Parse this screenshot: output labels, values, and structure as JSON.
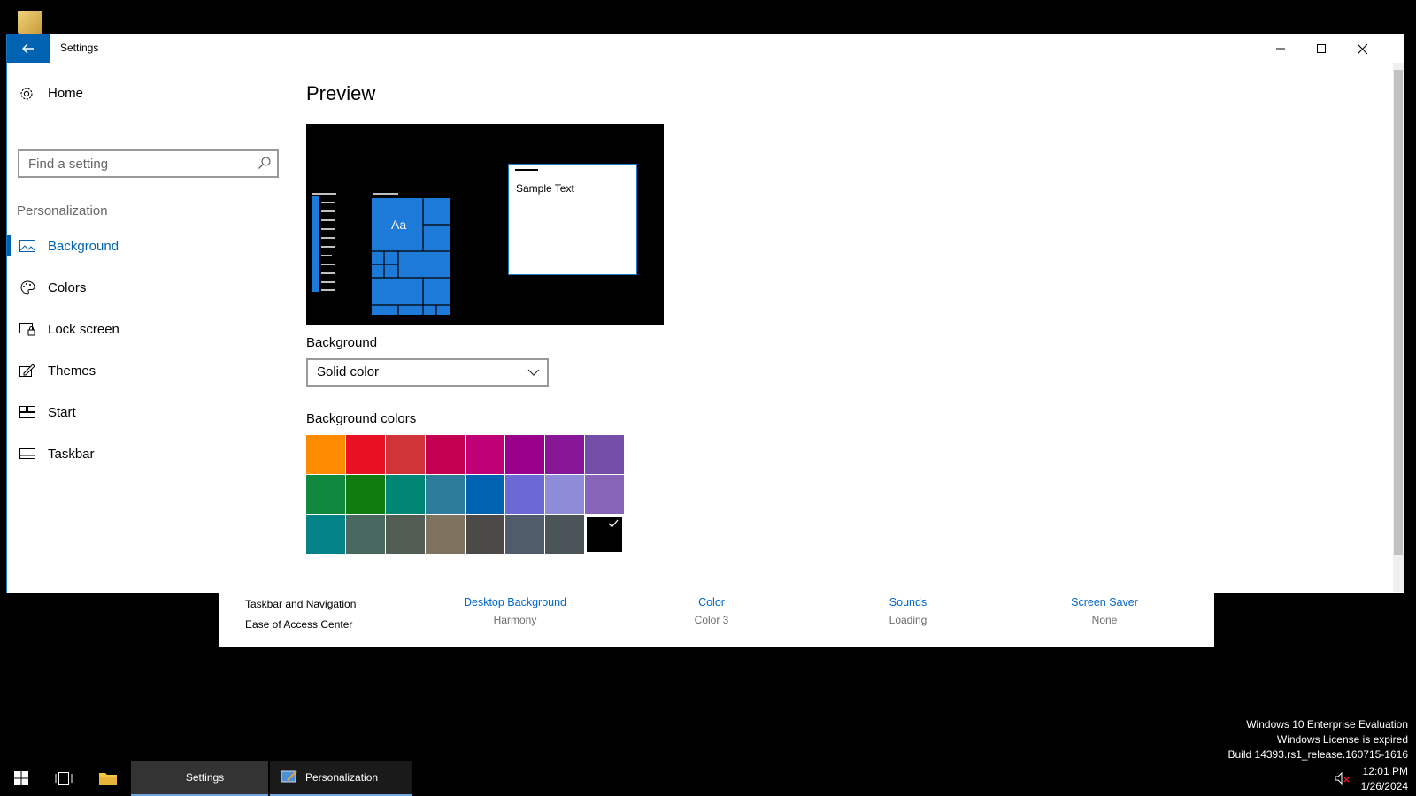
{
  "window": {
    "title": "Settings"
  },
  "nav": {
    "home": "Home",
    "search_placeholder": "Find a setting",
    "section": "Personalization",
    "items": [
      {
        "label": "Background",
        "icon": "picture-icon",
        "active": true
      },
      {
        "label": "Colors",
        "icon": "palette-icon"
      },
      {
        "label": "Lock screen",
        "icon": "lock-screen-icon"
      },
      {
        "label": "Themes",
        "icon": "themes-icon"
      },
      {
        "label": "Start",
        "icon": "start-icon"
      },
      {
        "label": "Taskbar",
        "icon": "taskbar-icon"
      }
    ]
  },
  "main": {
    "preview_heading": "Preview",
    "preview_tile_text": "Aa",
    "preview_sample_text": "Sample Text",
    "background_label": "Background",
    "background_value": "Solid color",
    "colors_label": "Background colors",
    "colors": [
      "#ff8c00",
      "#e81123",
      "#d13438",
      "#c30052",
      "#bf0077",
      "#9a0089",
      "#881798",
      "#744da9",
      "#10893e",
      "#107c10",
      "#018574",
      "#2d7d9a",
      "#0063b1",
      "#6b69d6",
      "#8e8cd8",
      "#8764b8",
      "#038387",
      "#486860",
      "#525e54",
      "#7e735f",
      "#4c4a48",
      "#515c6b",
      "#4a5459",
      "#000000"
    ],
    "selected_color_index": 23
  },
  "control_panel": {
    "links": [
      "Taskbar and Navigation",
      "Ease of Access Center"
    ],
    "items": [
      {
        "title": "Desktop Background",
        "subtitle": "Harmony"
      },
      {
        "title": "Color",
        "subtitle": "Color 3"
      },
      {
        "title": "Sounds",
        "subtitle": "Loading"
      },
      {
        "title": "Screen Saver",
        "subtitle": "None"
      }
    ]
  },
  "taskbar": {
    "apps": [
      "Settings",
      "Personalization"
    ],
    "time": "12:01 PM",
    "date": "1/26/2024"
  },
  "watermark": {
    "line1": "Windows 10 Enterprise Evaluation",
    "line2": "Windows License is expired",
    "line3": "Build 14393.rs1_release.160715-1616"
  },
  "accent": "#0063b1"
}
